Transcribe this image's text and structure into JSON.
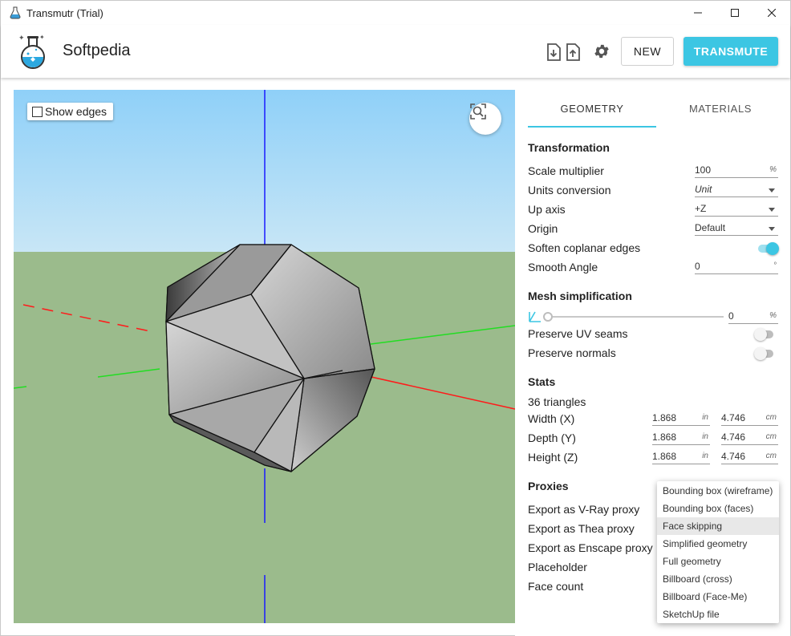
{
  "window": {
    "title": "Transmutr (Trial)",
    "minimize": "—",
    "maximize": "☐",
    "close": "✕"
  },
  "header": {
    "brand": "Softpedia",
    "new_label": "NEW",
    "transmute_label": "TRANSMUTE",
    "icons": [
      "file-import-icon",
      "file-export-icon",
      "gear-icon"
    ]
  },
  "viewport": {
    "show_edges_label": "Show edges",
    "show_edges_checked": false
  },
  "tabs": [
    {
      "label": "GEOMETRY",
      "active": true
    },
    {
      "label": "MATERIALS",
      "active": false
    }
  ],
  "transformation": {
    "title": "Transformation",
    "scale": {
      "label": "Scale multiplier",
      "value": "100",
      "unit": "%"
    },
    "units": {
      "label": "Units conversion",
      "value": "Unit"
    },
    "up_axis": {
      "label": "Up axis",
      "value": "+Z"
    },
    "origin": {
      "label": "Origin",
      "value": "Default"
    },
    "soften": {
      "label": "Soften coplanar edges",
      "on": true
    },
    "smooth": {
      "label": "Smooth Angle",
      "value": "0",
      "unit": "°"
    }
  },
  "mesh": {
    "title": "Mesh simplification",
    "value": "0",
    "unit": "%",
    "uv": {
      "label": "Preserve UV seams",
      "on": false
    },
    "normals": {
      "label": "Preserve normals",
      "on": false
    }
  },
  "stats": {
    "title": "Stats",
    "triangles": "36 triangles",
    "rows": [
      {
        "label": "Width (X)",
        "v1": "1.868",
        "u1": "in",
        "v2": "4.746",
        "u2": "cm"
      },
      {
        "label": "Depth (Y)",
        "v1": "1.868",
        "u1": "in",
        "v2": "4.746",
        "u2": "cm"
      },
      {
        "label": "Height (Z)",
        "v1": "1.868",
        "u1": "in",
        "v2": "4.746",
        "u2": "cm"
      }
    ]
  },
  "proxies": {
    "title": "Proxies",
    "rows": [
      "Export as V-Ray proxy",
      "Export as Thea proxy",
      "Export as Enscape proxy",
      "Placeholder",
      "Face count"
    ]
  },
  "menu": {
    "items": [
      "Bounding box (wireframe)",
      "Bounding box (faces)",
      "Face skipping",
      "Simplified geometry",
      "Full geometry",
      "Billboard (cross)",
      "Billboard (Face-Me)",
      "SketchUp file"
    ],
    "active_index": 2
  },
  "colors": {
    "accent": "#3cc6e3",
    "sky": "#a8d8f5",
    "ground": "#9bbb8c",
    "axis_x": "#ff1a1a",
    "axis_y": "#22dd22",
    "axis_z": "#1a1aff"
  }
}
